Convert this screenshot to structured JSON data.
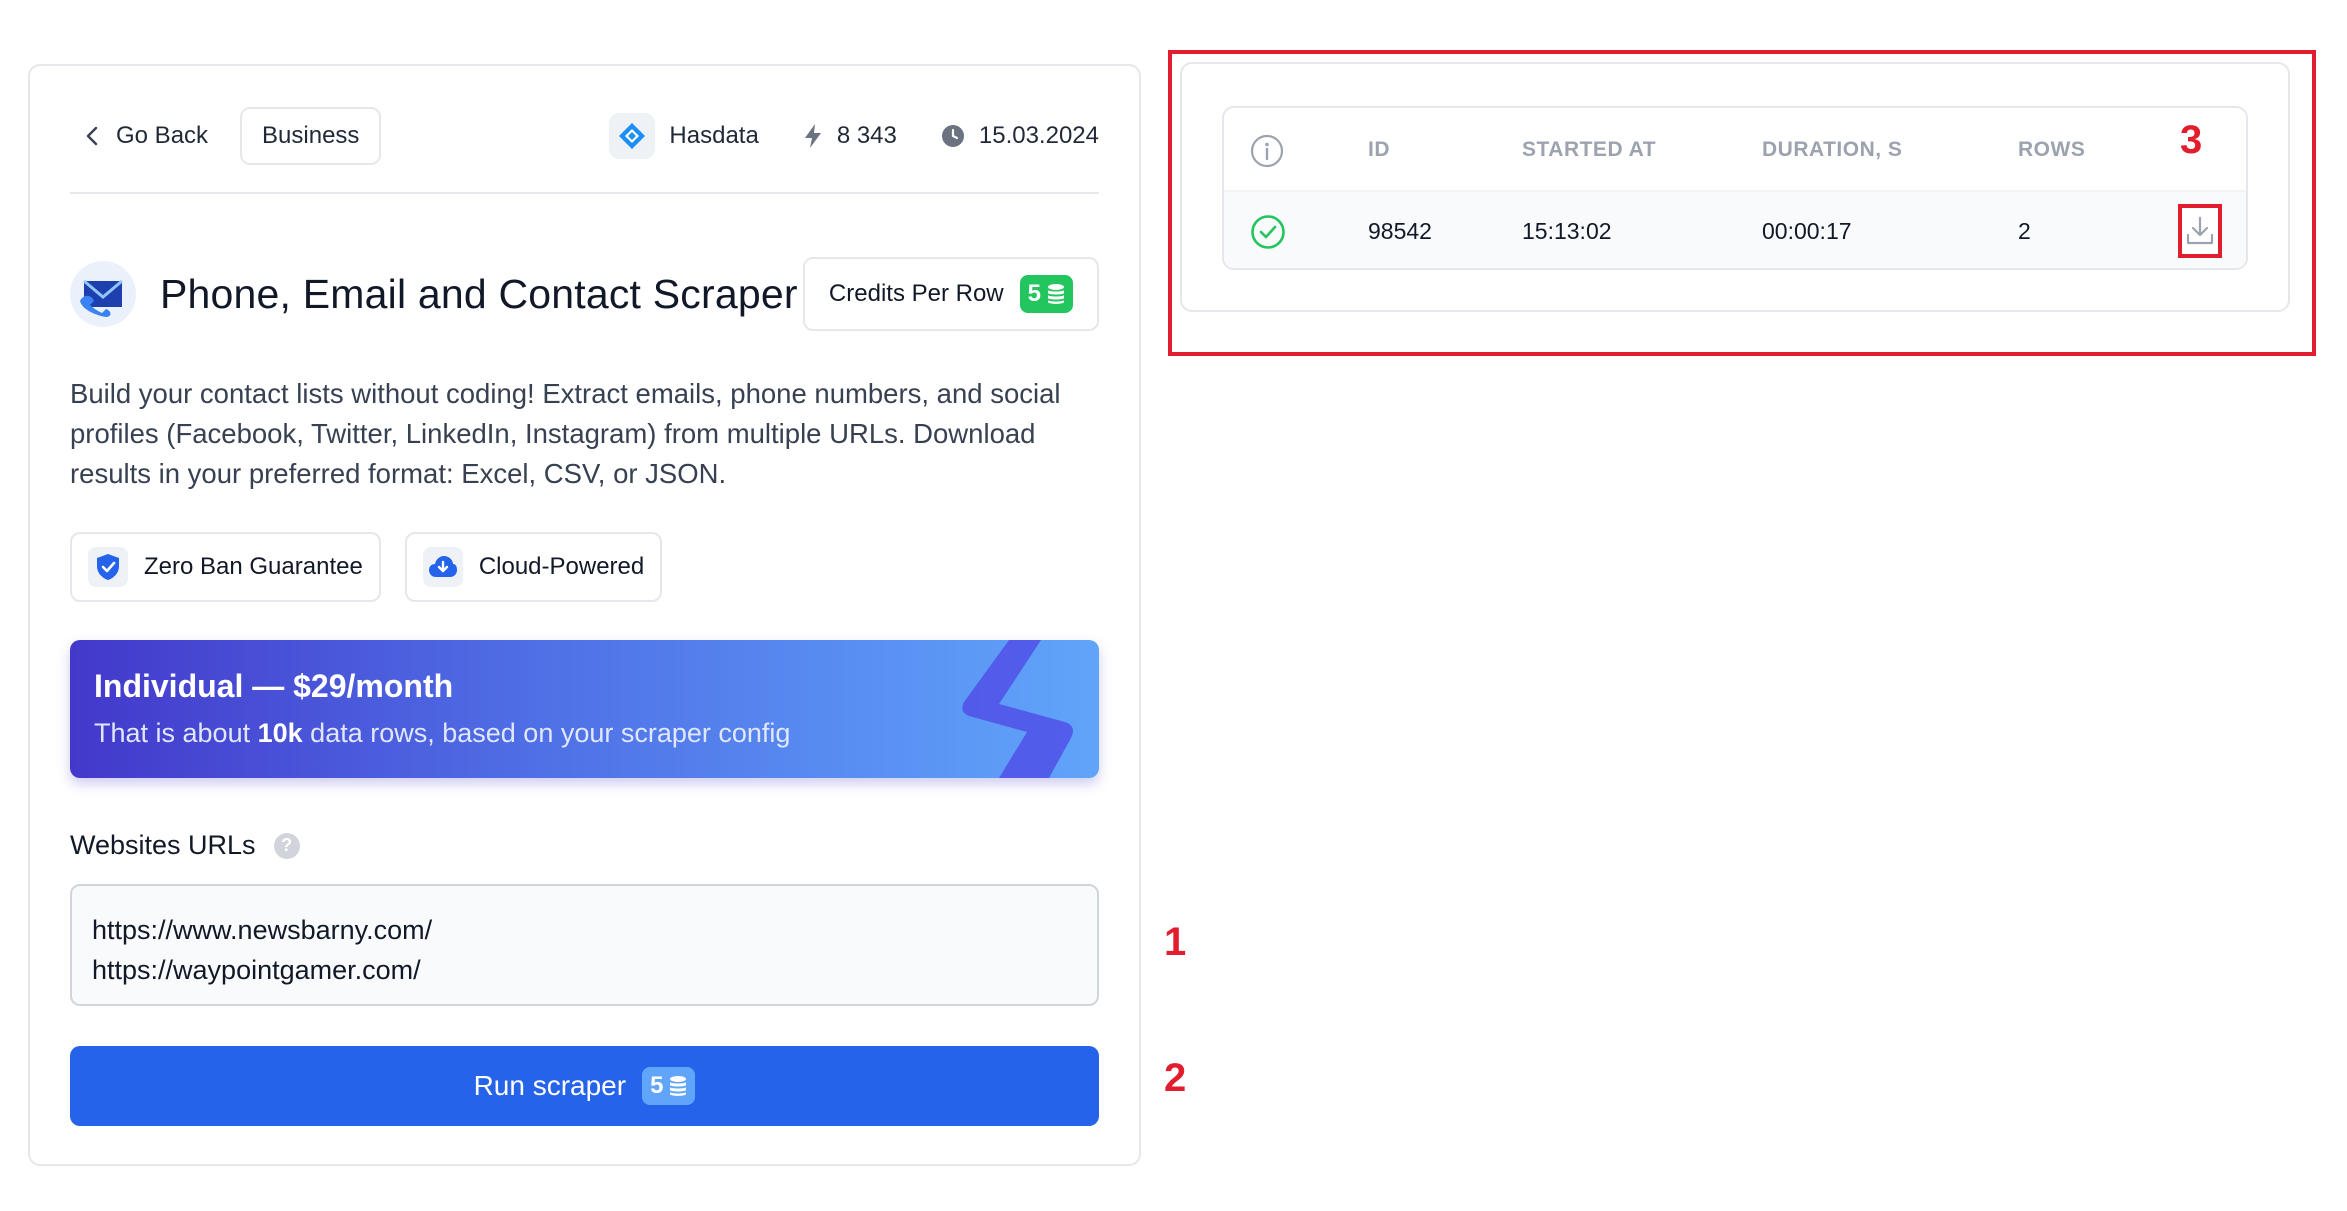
{
  "topbar": {
    "go_back": "Go Back",
    "category": "Business",
    "vendor": "Hasdata",
    "runs": "8 343",
    "date": "15.03.2024"
  },
  "scraper": {
    "title": "Phone, Email and Contact Scraper",
    "credits_label": "Credits Per Row",
    "credits_value": "5",
    "description": "Build your contact lists without coding! Extract emails, phone numbers, and social profiles (Facebook, Twitter, LinkedIn, Instagram) from multiple URLs. Download results in your preferred format: Excel, CSV, or JSON."
  },
  "features": [
    {
      "label": "Zero Ban Guarantee"
    },
    {
      "label": "Cloud-Powered"
    }
  ],
  "plan": {
    "title": "Individual — $29/month",
    "sub_prefix": "That is about ",
    "sub_bold": "10k",
    "sub_suffix": " data rows, based on your scraper config"
  },
  "urls": {
    "label": "Websites URLs",
    "help": "?",
    "lines": [
      "https://www.newsbarny.com/",
      "https://waypointgamer.com/"
    ]
  },
  "run_button": {
    "label": "Run scraper",
    "credits": "5"
  },
  "annotations": [
    "1",
    "2",
    "3"
  ],
  "results_table": {
    "headers": [
      "ID",
      "STARTED AT",
      "DURATION, S",
      "ROWS"
    ],
    "rows": [
      {
        "id": "98542",
        "started_at": "15:13:02",
        "duration": "00:00:17",
        "rows": "2"
      }
    ]
  },
  "colors": {
    "primary": "#2563eb",
    "success": "#22c55e",
    "annotation": "#e11d2e",
    "plan_gradient_start": "#4338ca",
    "plan_gradient_end": "#60a5fa"
  }
}
